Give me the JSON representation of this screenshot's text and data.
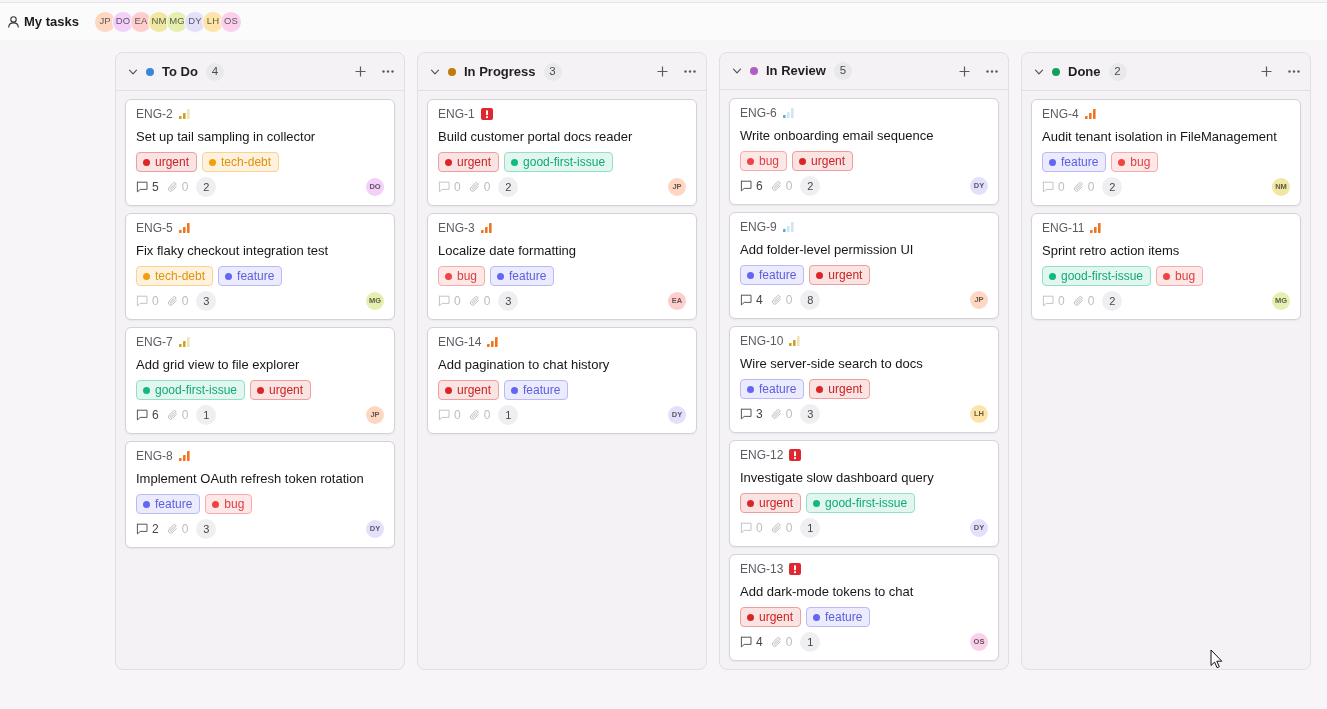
{
  "header": {
    "title": "My tasks",
    "members": [
      {
        "initials": "JP",
        "color": "#fed7c3"
      },
      {
        "initials": "DO",
        "color": "#f3d0fa"
      },
      {
        "initials": "EA",
        "color": "#fecdcd"
      },
      {
        "initials": "NM",
        "color": "#efe8a3"
      },
      {
        "initials": "MG",
        "color": "#e6eeb0"
      },
      {
        "initials": "DY",
        "color": "#e2e0fb"
      },
      {
        "initials": "LH",
        "color": "#fde4a8"
      },
      {
        "initials": "OS",
        "color": "#fbd0ea"
      }
    ]
  },
  "columns": [
    {
      "title": "To Do",
      "color": "#3a86dd",
      "count": "4",
      "expanded": true,
      "cards": [
        {
          "id": "ENG-2",
          "priority": {
            "kind": "medium"
          },
          "title": "Set up tail sampling in collector",
          "labels": [
            {
              "name": "urgent",
              "color": "#dc2626"
            },
            {
              "name": "tech-debt",
              "color": "#f59e0b"
            }
          ],
          "comments": {
            "count": "5",
            "muted": false
          },
          "attachments": "0",
          "subtasks": "2",
          "assignee": {
            "initials": "DO",
            "color": "#f3d0fa"
          }
        },
        {
          "id": "ENG-5",
          "priority": {
            "kind": "high"
          },
          "title": "Fix flaky checkout integration test",
          "labels": [
            {
              "name": "tech-debt",
              "color": "#f59e0b"
            },
            {
              "name": "feature",
              "color": "#6366f1"
            }
          ],
          "comments": {
            "count": "0",
            "muted": true
          },
          "attachments": "0",
          "subtasks": "3",
          "assignee": {
            "initials": "MG",
            "color": "#e6eeb0"
          }
        },
        {
          "id": "ENG-7",
          "priority": {
            "kind": "medium"
          },
          "title": "Add grid view to file explorer",
          "labels": [
            {
              "name": "good-first-issue",
              "color": "#10b981"
            },
            {
              "name": "urgent",
              "color": "#dc2626"
            }
          ],
          "comments": {
            "count": "6",
            "muted": false
          },
          "attachments": "0",
          "subtasks": "1",
          "assignee": {
            "initials": "JP",
            "color": "#fed7c3"
          }
        },
        {
          "id": "ENG-8",
          "priority": {
            "kind": "high"
          },
          "title": "Implement OAuth refresh token rotation",
          "labels": [
            {
              "name": "feature",
              "color": "#6366f1"
            },
            {
              "name": "bug",
              "color": "#ef4444"
            }
          ],
          "comments": {
            "count": "2",
            "muted": false
          },
          "attachments": "0",
          "subtasks": "3",
          "assignee": {
            "initials": "DY",
            "color": "#e2e0fb"
          }
        }
      ]
    },
    {
      "title": "In Progress",
      "color": "#c27a0a",
      "count": "3",
      "expanded": true,
      "cards": [
        {
          "id": "ENG-1",
          "priority": {
            "kind": "urgent"
          },
          "title": "Build customer portal docs reader",
          "labels": [
            {
              "name": "urgent",
              "color": "#dc2626"
            },
            {
              "name": "good-first-issue",
              "color": "#10b981"
            }
          ],
          "comments": {
            "count": "0",
            "muted": true
          },
          "attachments": "0",
          "subtasks": "2",
          "assignee": {
            "initials": "JP",
            "color": "#fed7c3"
          }
        },
        {
          "id": "ENG-3",
          "priority": {
            "kind": "high"
          },
          "title": "Localize date formatting",
          "labels": [
            {
              "name": "bug",
              "color": "#ef4444"
            },
            {
              "name": "feature",
              "color": "#6366f1"
            }
          ],
          "comments": {
            "count": "0",
            "muted": true
          },
          "attachments": "0",
          "subtasks": "3",
          "assignee": {
            "initials": "EA",
            "color": "#fecdcd"
          }
        },
        {
          "id": "ENG-14",
          "priority": {
            "kind": "high"
          },
          "title": "Add pagination to chat history",
          "labels": [
            {
              "name": "urgent",
              "color": "#dc2626"
            },
            {
              "name": "feature",
              "color": "#6366f1"
            }
          ],
          "comments": {
            "count": "0",
            "muted": true
          },
          "attachments": "0",
          "subtasks": "1",
          "assignee": {
            "initials": "DY",
            "color": "#e2e0fb"
          }
        }
      ]
    },
    {
      "title": "In Review",
      "color": "#b05cc6",
      "count": "5",
      "expanded": true,
      "cards": [
        {
          "id": "ENG-6",
          "priority": {
            "kind": "low"
          },
          "title": "Write onboarding email sequence",
          "labels": [
            {
              "name": "bug",
              "color": "#ef4444"
            },
            {
              "name": "urgent",
              "color": "#dc2626"
            }
          ],
          "comments": {
            "count": "6",
            "muted": false
          },
          "attachments": "0",
          "subtasks": "2",
          "assignee": {
            "initials": "DY",
            "color": "#e2e0fb"
          }
        },
        {
          "id": "ENG-9",
          "priority": {
            "kind": "low"
          },
          "title": "Add folder-level permission UI",
          "labels": [
            {
              "name": "feature",
              "color": "#6366f1"
            },
            {
              "name": "urgent",
              "color": "#dc2626"
            }
          ],
          "comments": {
            "count": "4",
            "muted": false
          },
          "attachments": "0",
          "subtasks": "8",
          "assignee": {
            "initials": "JP",
            "color": "#fed7c3"
          }
        },
        {
          "id": "ENG-10",
          "priority": {
            "kind": "medium"
          },
          "title": "Wire server-side search to docs",
          "labels": [
            {
              "name": "feature",
              "color": "#6366f1"
            },
            {
              "name": "urgent",
              "color": "#dc2626"
            }
          ],
          "comments": {
            "count": "3",
            "muted": false
          },
          "attachments": "0",
          "subtasks": "3",
          "assignee": {
            "initials": "LH",
            "color": "#fde4a8"
          }
        },
        {
          "id": "ENG-12",
          "priority": {
            "kind": "urgent"
          },
          "title": "Investigate slow dashboard query",
          "labels": [
            {
              "name": "urgent",
              "color": "#dc2626"
            },
            {
              "name": "good-first-issue",
              "color": "#10b981"
            }
          ],
          "comments": {
            "count": "0",
            "muted": true
          },
          "attachments": "0",
          "subtasks": "1",
          "assignee": {
            "initials": "DY",
            "color": "#e2e0fb"
          }
        },
        {
          "id": "ENG-13",
          "priority": {
            "kind": "urgent"
          },
          "title": "Add dark-mode tokens to chat",
          "labels": [
            {
              "name": "urgent",
              "color": "#dc2626"
            },
            {
              "name": "feature",
              "color": "#6366f1"
            }
          ],
          "comments": {
            "count": "4",
            "muted": false
          },
          "attachments": "0",
          "subtasks": "1",
          "assignee": {
            "initials": "OS",
            "color": "#fbd0ea"
          }
        }
      ]
    },
    {
      "title": "Done",
      "color": "#12a05c",
      "count": "2",
      "expanded": true,
      "cards": [
        {
          "id": "ENG-4",
          "priority": {
            "kind": "high"
          },
          "title": "Audit tenant isolation in FileManagement",
          "labels": [
            {
              "name": "feature",
              "color": "#6366f1"
            },
            {
              "name": "bug",
              "color": "#ef4444"
            }
          ],
          "comments": {
            "count": "0",
            "muted": true
          },
          "attachments": "0",
          "subtasks": "2",
          "assignee": {
            "initials": "NM",
            "color": "#efe8a3"
          }
        },
        {
          "id": "ENG-11",
          "priority": {
            "kind": "high"
          },
          "title": "Sprint retro action items",
          "labels": [
            {
              "name": "good-first-issue",
              "color": "#10b981"
            },
            {
              "name": "bug",
              "color": "#ef4444"
            }
          ],
          "comments": {
            "count": "0",
            "muted": true
          },
          "attachments": "0",
          "subtasks": "2",
          "assignee": {
            "initials": "MG",
            "color": "#e6eeb0"
          }
        }
      ]
    }
  ]
}
